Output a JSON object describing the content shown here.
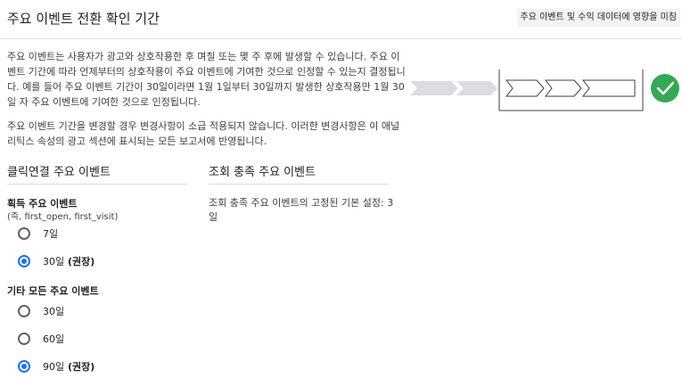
{
  "header": {
    "title": "주요 이벤트 전환 확인 기간",
    "badge": "주요 이벤트 및 수익 데이터에 영향을 미침"
  },
  "description": {
    "paragraph1": "주요 이벤트는 사용자가 광고와 상호작용한 후 며칠 또는 몇 주 후에 발생할 수 있습니다. 주요 이벤트 기간에 따라 언제부터의 상호작용이 주요 이벤트에 기여한 것으로 인정할 수 있는지 결정됩니다. 예를 들어 주요 이벤트 기간이 30일이라면 1월 1일부터 30일까지 발생한 상호작용만 1월 30일 자 주요 이벤트에 기여한 것으로 인정됩니다.",
    "paragraph2": "주요 이벤트 기간을 변경할 경우 변경사항이 소급 적용되지 않습니다. 이러한 변경사항은 이 애널리틱스 속성의 광고 섹션에 표시되는 모든 보고서에 반영됩니다."
  },
  "colors": {
    "accent": "#1a73e8",
    "success": "#34a853",
    "arrow_gray": "#dadce0"
  },
  "click_section": {
    "title": "클릭연결 주요 이벤트",
    "acquisition": {
      "title": "획득 주요 이벤트",
      "subtitle": "(즉, first_open, first_visit)",
      "options": [
        {
          "label": "7일",
          "suffix": "",
          "selected": false
        },
        {
          "label": "30일",
          "suffix": " (권장)",
          "selected": true
        }
      ]
    },
    "other": {
      "title": "기타 모든 주요 이벤트",
      "options": [
        {
          "label": "30일",
          "suffix": "",
          "selected": false
        },
        {
          "label": "60일",
          "suffix": "",
          "selected": false
        },
        {
          "label": "90일",
          "suffix": " (권장)",
          "selected": true
        }
      ]
    }
  },
  "view_section": {
    "title": "조회 충족 주요 이벤트",
    "text": "조회 충족 주요 이벤트의 고정된 기본 설정: 3일"
  }
}
